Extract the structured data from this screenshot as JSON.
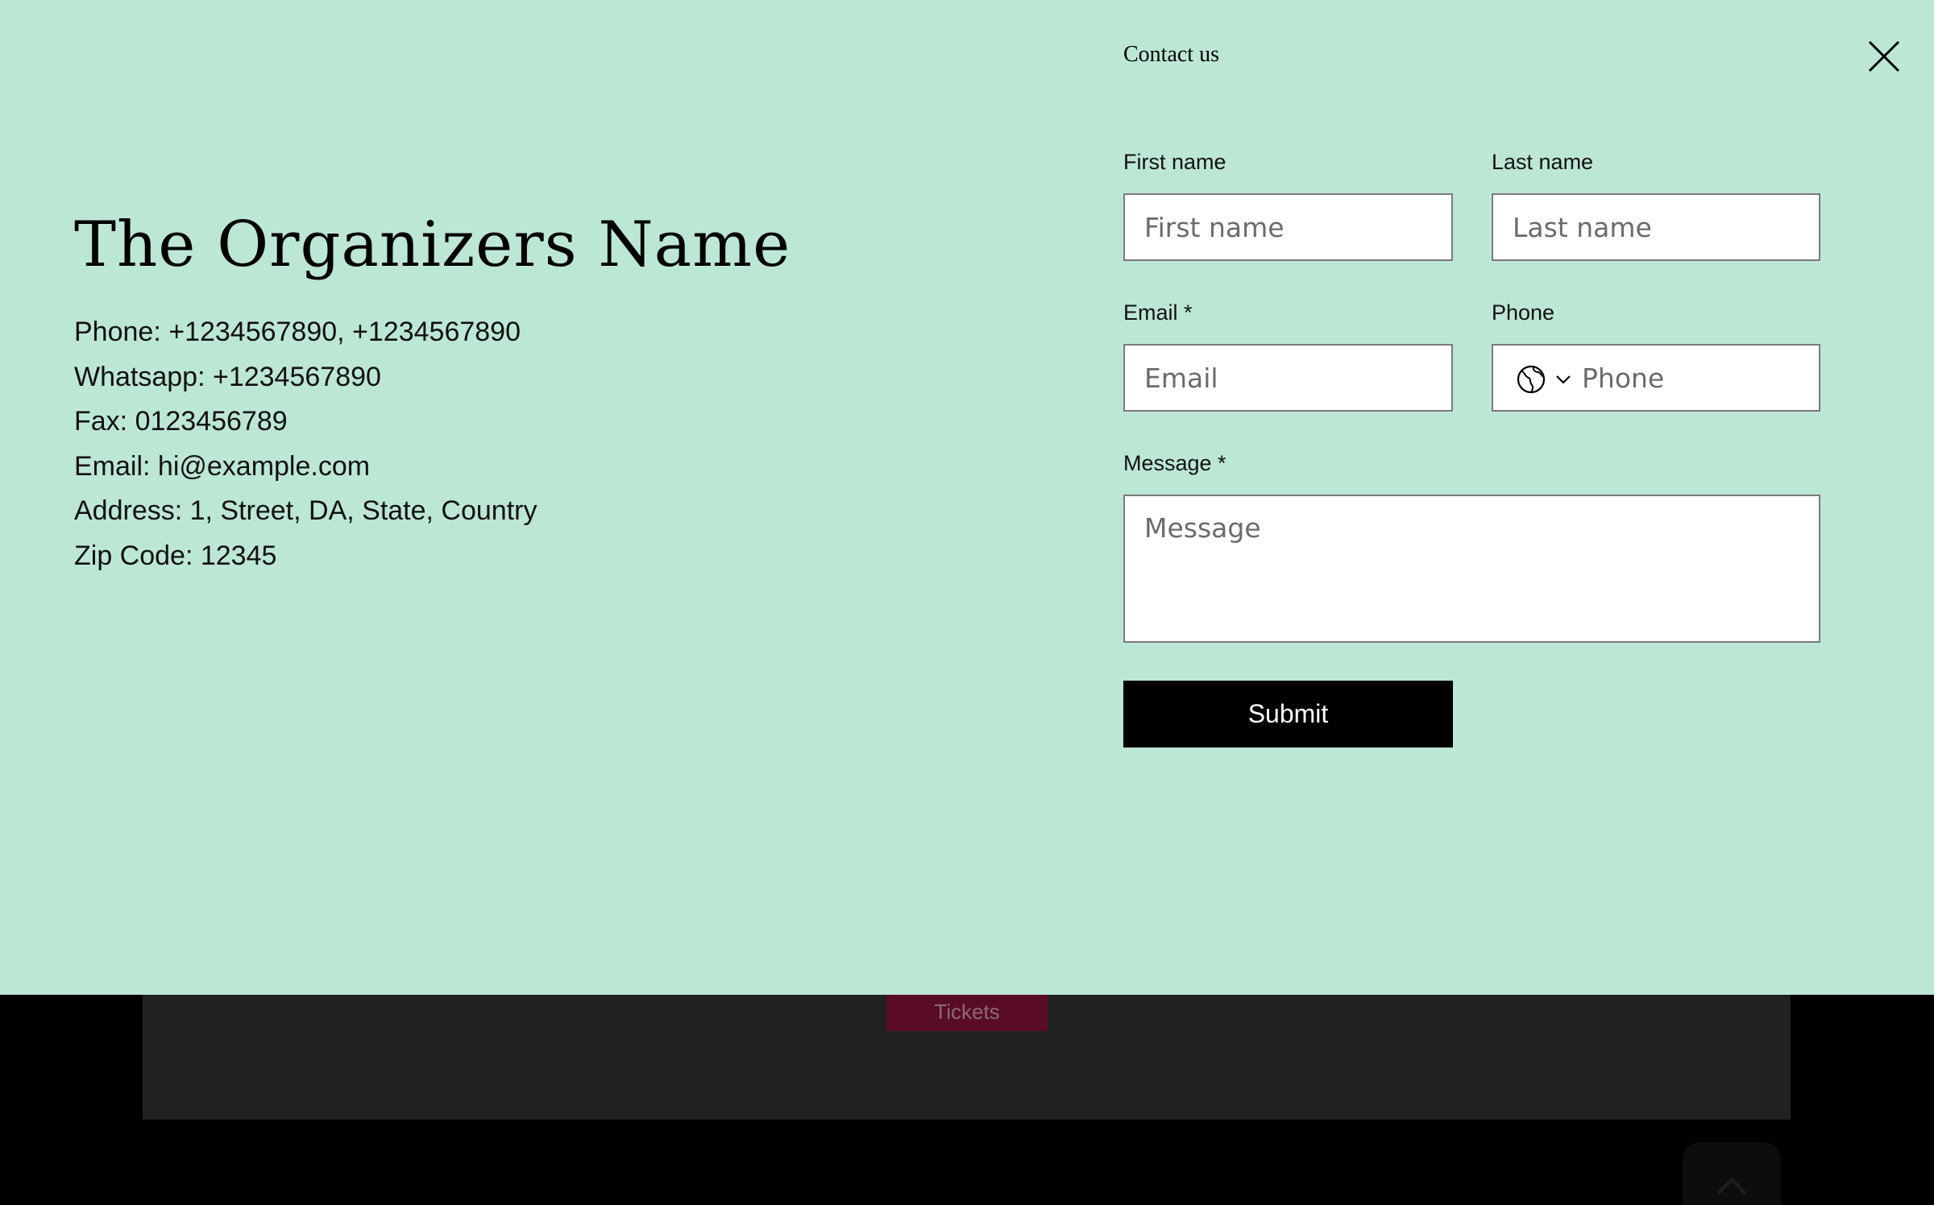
{
  "background": {
    "tickets_label": "Tickets"
  },
  "organizer": {
    "name": "The Organizers Name",
    "lines": [
      "Phone: +1234567890, +1234567890",
      "Whatsapp: +1234567890",
      "Fax: 0123456789",
      "Email: hi@example.com",
      "Address: 1, Street, DA, State, Country",
      "Zip Code: 12345"
    ]
  },
  "form": {
    "heading": "Contact us",
    "first_name": {
      "label": "First name",
      "placeholder": "First name"
    },
    "last_name": {
      "label": "Last name",
      "placeholder": "Last name"
    },
    "email": {
      "label": "Email *",
      "placeholder": "Email"
    },
    "phone": {
      "label": "Phone",
      "placeholder": "Phone"
    },
    "message": {
      "label": "Message *",
      "placeholder": "Message"
    },
    "submit_label": "Submit"
  },
  "colors": {
    "overlay_bg": "#bde7d5",
    "submit_bg": "#000000",
    "tickets_bg": "#5a0b25"
  },
  "icons": {
    "close": "close-icon",
    "globe": "globe-icon",
    "chevron": "chevron-down-icon",
    "scroll_top": "arrow-up-icon"
  }
}
